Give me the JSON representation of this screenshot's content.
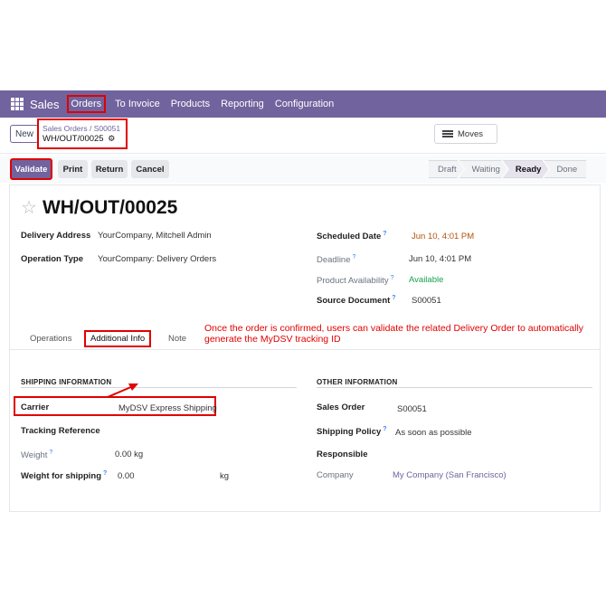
{
  "navbar": {
    "app_name": "Sales",
    "items": [
      "Orders",
      "To Invoice",
      "Products",
      "Reporting",
      "Configuration"
    ]
  },
  "control": {
    "new_label": "New",
    "breadcrumb": [
      "Sales Orders",
      "S00051"
    ],
    "breadcrumb_sep": "/",
    "record_name": "WH/OUT/00025",
    "moves_label": "Moves"
  },
  "actions": {
    "validate": "Validate",
    "print": "Print",
    "return": "Return",
    "cancel": "Cancel"
  },
  "statusbar": {
    "stages": [
      "Draft",
      "Waiting",
      "Ready",
      "Done"
    ],
    "active": "Ready"
  },
  "record": {
    "title": "WH/OUT/00025",
    "left_fields": [
      {
        "label": "Delivery Address",
        "value": "YourCompany, Mitchell Admin"
      },
      {
        "label": "Operation Type",
        "value": "YourCompany: Delivery Orders"
      }
    ],
    "right_fields": [
      {
        "label": "Scheduled Date",
        "value": "Jun 10, 4:01 PM"
      },
      {
        "label": "Deadline",
        "value": "Jun 10, 4:01 PM"
      },
      {
        "label": "Product Availability",
        "value": "Available"
      },
      {
        "label": "Source Document",
        "value": "S00051"
      }
    ],
    "help_mark": "?"
  },
  "tabs": [
    "Operations",
    "Additional Info",
    "Note"
  ],
  "annotation": "Once the order is confirmed, users can validate the related Delivery Order to automatically generate the MyDSV tracking ID",
  "shipping": {
    "heading": "SHIPPING INFORMATION",
    "carrier_label": "Carrier",
    "carrier_value": "MyDSV Express Shipping",
    "tracking_label": "Tracking Reference",
    "weight_label": "Weight",
    "weight_value": "0.00 kg",
    "weight_shipping_label": "Weight for shipping",
    "weight_shipping_value": "0.00",
    "weight_shipping_unit": "kg"
  },
  "other": {
    "heading": "OTHER INFORMATION",
    "sales_order_label": "Sales Order",
    "sales_order_value": "S00051",
    "policy_label": "Shipping Policy",
    "policy_value": "As soon as possible",
    "responsible_label": "Responsible",
    "company_label": "Company",
    "company_value": "My Company (San Francisco)"
  },
  "colors": {
    "brand": "#71639e",
    "annotation": "#e00000",
    "available": "#16a34a",
    "scheduled": "#b45309"
  }
}
